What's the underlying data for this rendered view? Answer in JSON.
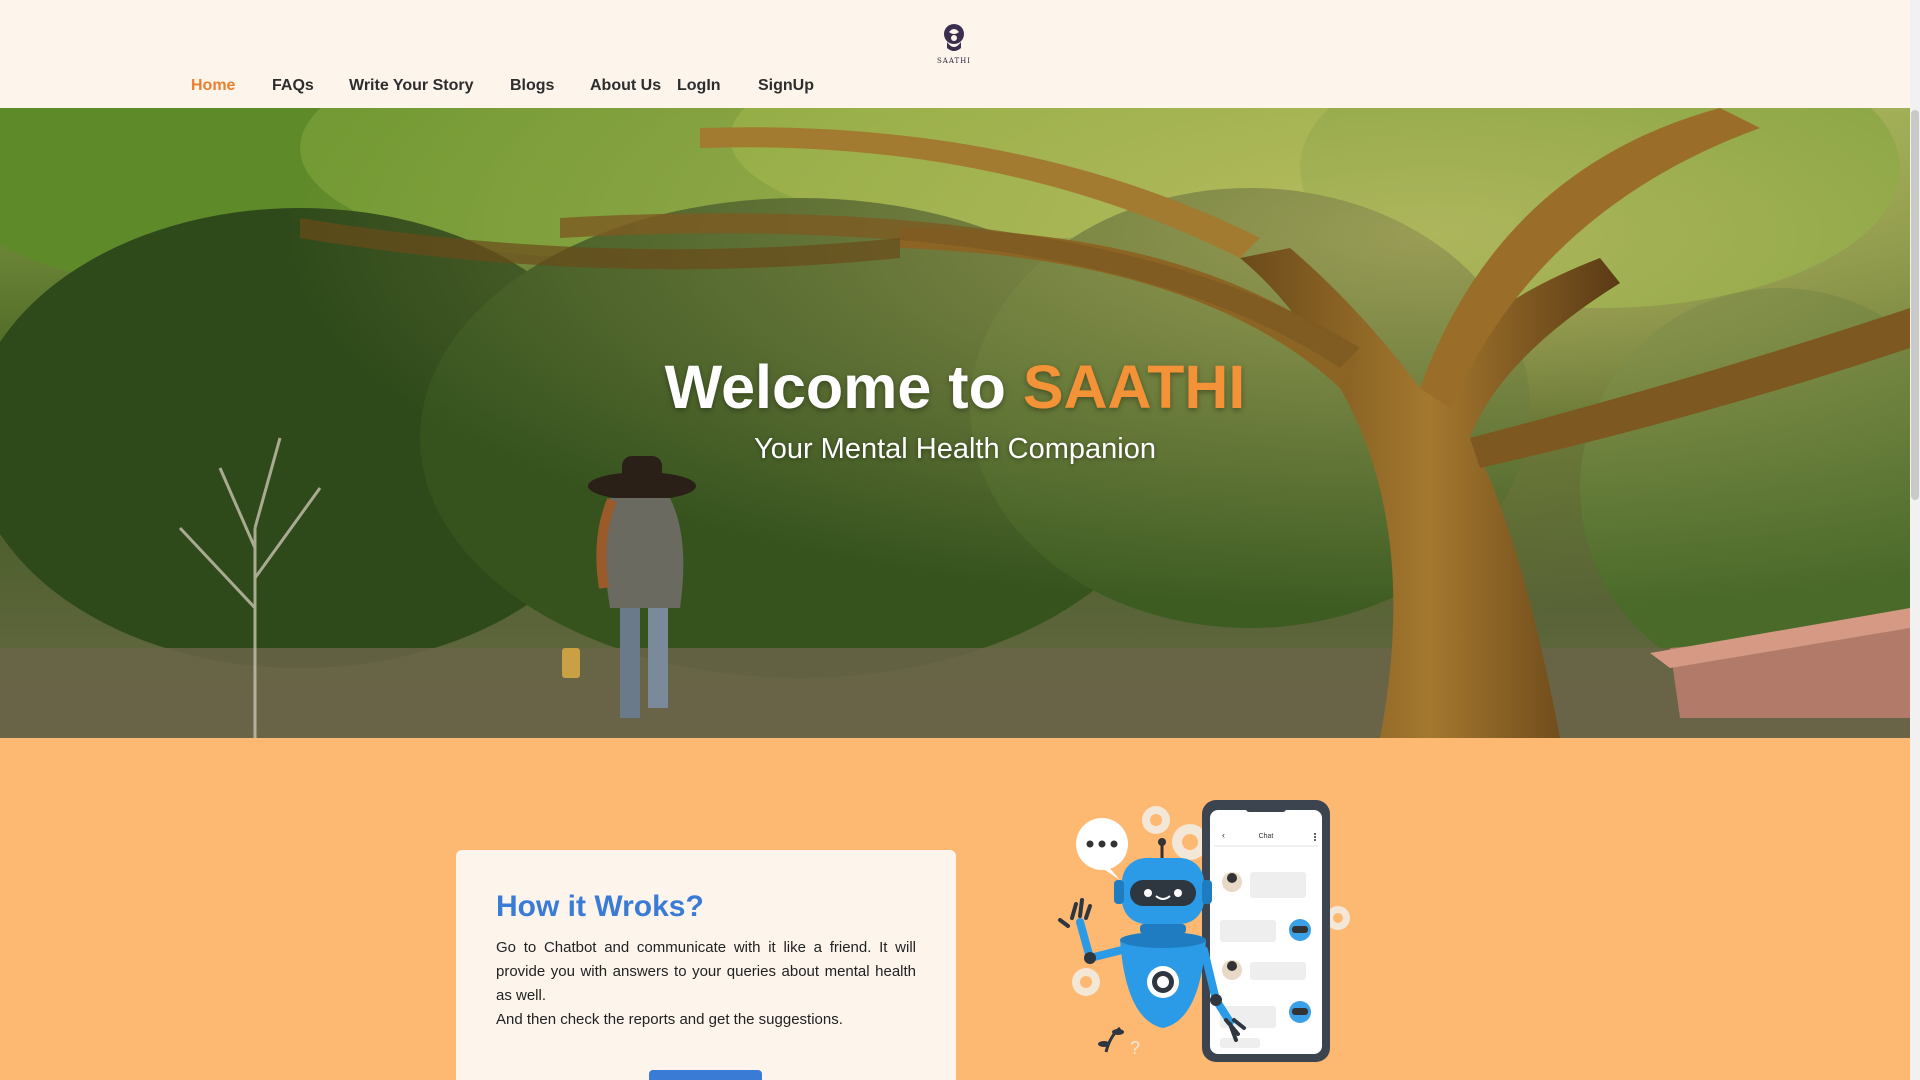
{
  "header": {
    "logo_text": "SAATHI",
    "nav": [
      {
        "label": "Home",
        "active": true
      },
      {
        "label": "FAQs",
        "active": false
      },
      {
        "label": "Write Your Story",
        "active": false
      },
      {
        "label": "Blogs",
        "active": false
      },
      {
        "label": "About Us",
        "active": false
      },
      {
        "label": "LogIn",
        "active": false
      },
      {
        "label": "SignUp",
        "active": false
      }
    ]
  },
  "hero": {
    "title_prefix": "Welcome to",
    "title_brand": "SAATHI",
    "subtitle": "Your Mental Health Companion"
  },
  "how_it_works": {
    "heading": "How it Wroks?",
    "paragraph1": "Go to Chatbot and communicate with it like a friend. It will provide you with answers to your queries about mental health as well.",
    "paragraph2": "And then check the reports and get the suggestions."
  },
  "illustration": {
    "phone_title": "Chat"
  },
  "colors": {
    "accent_orange": "#f39236",
    "nav_active": "#e97f2f",
    "section_bg": "#fdb871",
    "header_bg": "#fdf5ec",
    "heading_blue": "#3a7bd5"
  }
}
